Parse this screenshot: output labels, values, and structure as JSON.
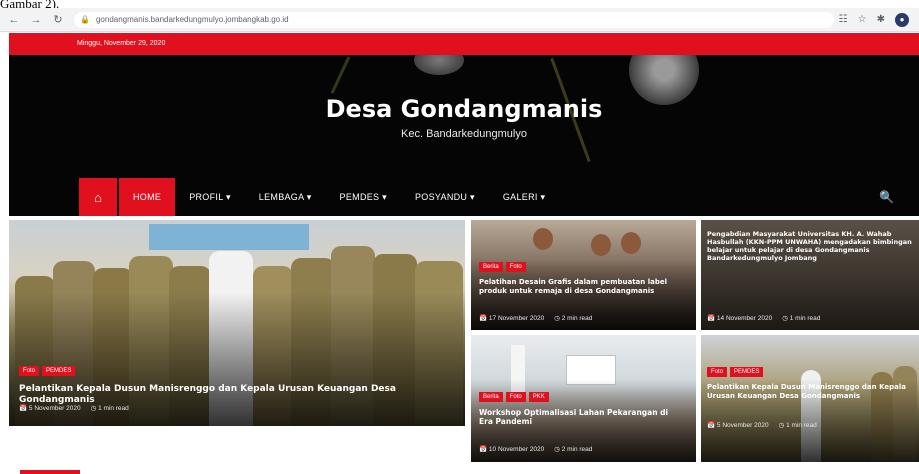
{
  "caption": "Gambar 2).",
  "browser": {
    "url": "gondangmanis.bandarkedungmulyo.jombangkab.go.id"
  },
  "topbar": {
    "date": "Minggu, November 29, 2020"
  },
  "header": {
    "title": "Desa Gondangmanis",
    "tagline": "Kec. Bandarkedungmulyo"
  },
  "nav": {
    "items": [
      "HOME",
      "PROFIL ▾",
      "LEMBAGA ▾",
      "PEMDES ▾",
      "POSYANDU ▾",
      "GALERI ▾"
    ]
  },
  "posts": [
    {
      "categories": [
        "Foto",
        "PEMDES"
      ],
      "title": "Pelantikan Kepala Dusun Manisrenggo dan Kepala Urusan Keuangan Desa Gondangmanis",
      "date": "5 November 2020",
      "read": "1 min read"
    },
    {
      "categories": [
        "Berita",
        "Foto"
      ],
      "title": "Pelatihan Desain Grafis dalam pembuatan label produk untuk remaja di desa Gondangmanis",
      "date": "17 November 2020",
      "read": "2 min read"
    },
    {
      "categories": [],
      "title": "Pengabdian Masyarakat Universitas KH. A. Wahab Hasbullah (KKN-PPM UNWAHA) mengadakan bimbingan belajar untuk pelajar di desa Gondangmanis Bandarkedungmulyo Jombang",
      "date": "14 November 2020",
      "read": "1 min read"
    },
    {
      "categories": [
        "Berita",
        "Foto",
        "PKK"
      ],
      "title": "Workshop Optimalisasi Lahan Pekarangan di Era Pandemi",
      "date": "10 November 2020",
      "read": "2 min read"
    },
    {
      "categories": [
        "Foto",
        "PEMDES"
      ],
      "title": "Pelantikan Kepala Dusun Manisrenggo dan Kepala Urusan Keuangan Desa Gondangmanis",
      "date": "5 November 2020",
      "read": "1 min read"
    }
  ],
  "colors": {
    "accent": "#e0101f",
    "header_bg": "#050505"
  },
  "icons": {
    "home": "home-icon",
    "search": "search-icon"
  }
}
